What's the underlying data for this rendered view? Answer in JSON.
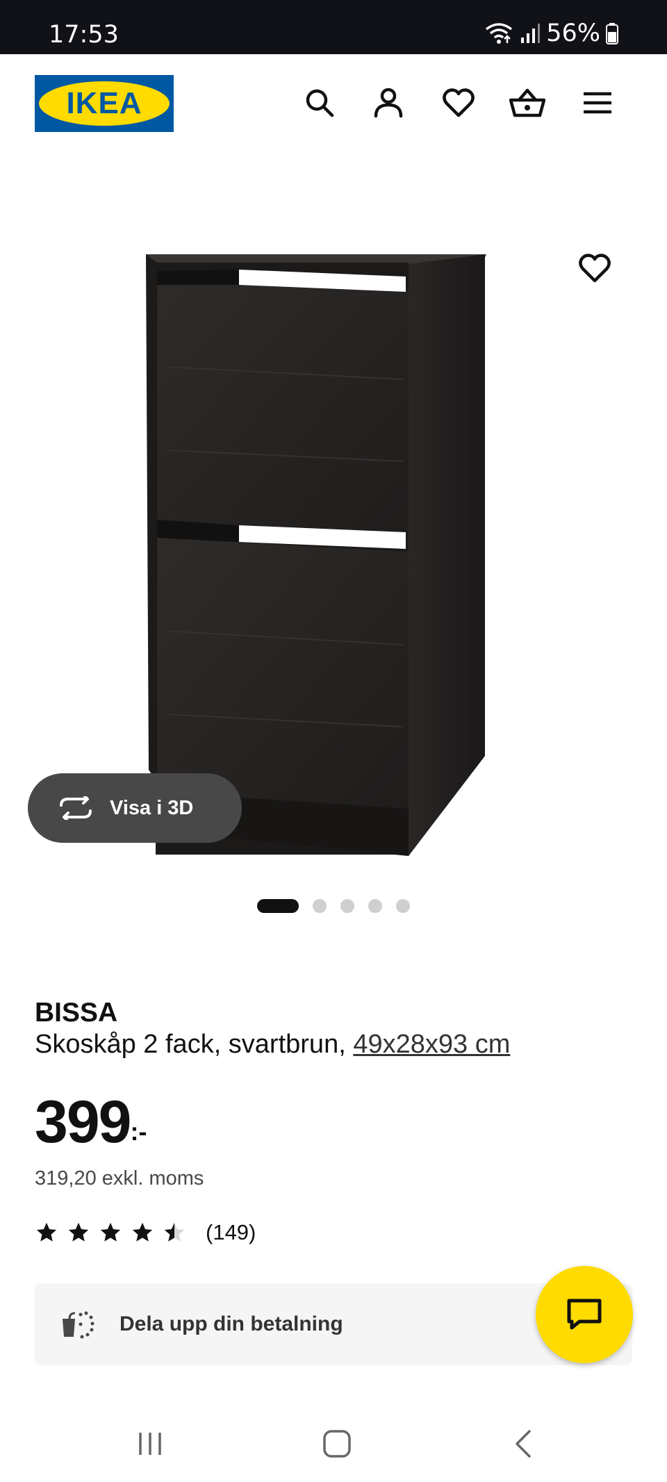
{
  "status_bar": {
    "time": "17:53",
    "battery": "56%",
    "icons": [
      "wifi-icon",
      "signal-icon",
      "battery-icon"
    ]
  },
  "header": {
    "logo_text": "IKEA",
    "icons": [
      "search-icon",
      "account-icon",
      "heart-icon",
      "cart-icon",
      "menu-icon"
    ]
  },
  "gallery": {
    "view_3d_label": "Visa i 3D",
    "dots_total": 5,
    "active_dot": 1
  },
  "product": {
    "name": "BISSA",
    "description": "Skoskåp 2 fack, svartbrun, ",
    "dimensions": "49x28x93 cm",
    "price": "399",
    "price_suffix": ":-",
    "price_ex_vat": "319,20 exkl. moms",
    "rating": 4.5,
    "rating_count": "(149)"
  },
  "payment": {
    "label": "Dela upp din betalning"
  },
  "colors": {
    "ikea_blue": "#0058a3",
    "ikea_yellow": "#ffdb00",
    "status_bar": "#111218",
    "pill_dark": "#484848"
  }
}
